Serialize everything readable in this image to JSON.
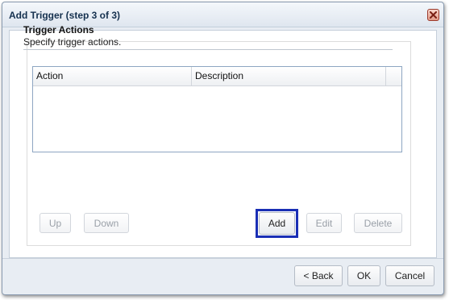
{
  "dialog": {
    "title": "Add Trigger (step 3 of 3)"
  },
  "section": {
    "title": "Trigger Actions",
    "subtitle": "Specify trigger actions."
  },
  "grid": {
    "columns": [
      "Action",
      "Description"
    ],
    "rows": []
  },
  "grid_buttons": {
    "up": "Up",
    "down": "Down",
    "add": "Add",
    "edit": "Edit",
    "delete": "Delete"
  },
  "footer": {
    "back": "< Back",
    "ok": "OK",
    "cancel": "Cancel"
  },
  "colors": {
    "title_text": "#15314f",
    "focus_border": "#1a2fb5",
    "close_button": "#e39b88"
  }
}
